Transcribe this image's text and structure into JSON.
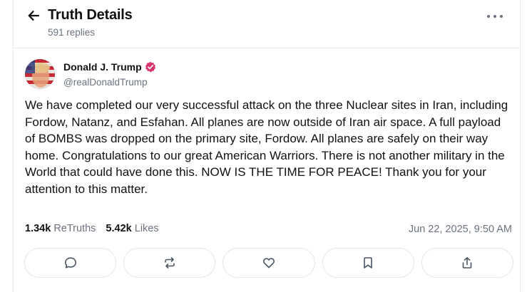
{
  "header": {
    "title": "Truth Details",
    "replies": "591 replies"
  },
  "post": {
    "author_name": "Donald J. Trump",
    "author_handle": "@realDonaldTrump",
    "verified": true,
    "body": "We have completed our very successful attack on the three Nuclear sites in Iran, including Fordow, Natanz, and Esfahan. All planes are now outside of Iran air space. A full payload of BOMBS was dropped on the primary site, Fordow. All planes are safely on their way home. Congratulations to our great American Warriors. There is not another military in the World that could have done this. NOW IS THE TIME FOR PEACE! Thank you for your attention to this matter.",
    "retruths_count": "1.34k",
    "retruths_label": "ReTruths",
    "likes_count": "5.42k",
    "likes_label": "Likes",
    "timestamp": "Jun 22, 2025, 9:50 AM"
  },
  "actions": [
    "reply-icon",
    "retruth-icon",
    "like-icon",
    "bookmark-icon",
    "share-icon"
  ],
  "colors": {
    "text": "#111111",
    "muted": "#6b7280",
    "border": "#e3e5e8",
    "verified_badge": "#d9356b"
  }
}
